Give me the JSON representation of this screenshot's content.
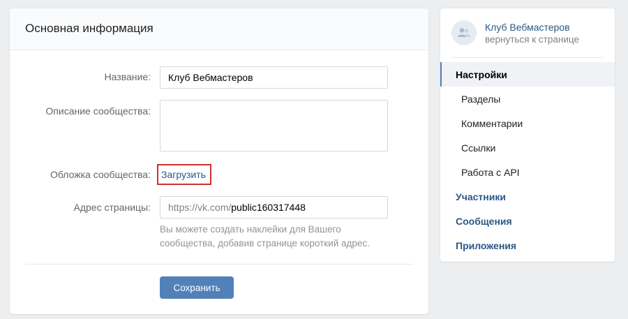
{
  "main": {
    "title": "Основная информация",
    "name_label": "Название:",
    "name_value": "Клуб Вебмастеров",
    "description_label": "Описание сообщества:",
    "description_value": "",
    "cover_label": "Обложка сообщества:",
    "cover_link": "Загрузить",
    "address_label": "Адрес страницы:",
    "address_prefix": "https://vk.com/",
    "address_value": "public160317448",
    "address_hint_line1": "Вы можете создать наклейки для Вашего",
    "address_hint_line2": "сообщества, добавив странице короткий адрес.",
    "save_label": "Сохранить"
  },
  "sidebar": {
    "club_name": "Клуб Вебмастеров",
    "back_link": "вернуться к странице",
    "items": [
      {
        "label": "Настройки",
        "active": true
      },
      {
        "label": "Разделы"
      },
      {
        "label": "Комментарии"
      },
      {
        "label": "Ссылки"
      },
      {
        "label": "Работа с API"
      },
      {
        "label": "Участники"
      },
      {
        "label": "Сообщения"
      },
      {
        "label": "Приложения"
      }
    ]
  },
  "icons": {
    "avatar": "community-users-icon"
  },
  "colors": {
    "accent": "#5181b8",
    "link": "#2a5885",
    "highlight_border": "#d32f2f",
    "background": "#edeef0"
  }
}
